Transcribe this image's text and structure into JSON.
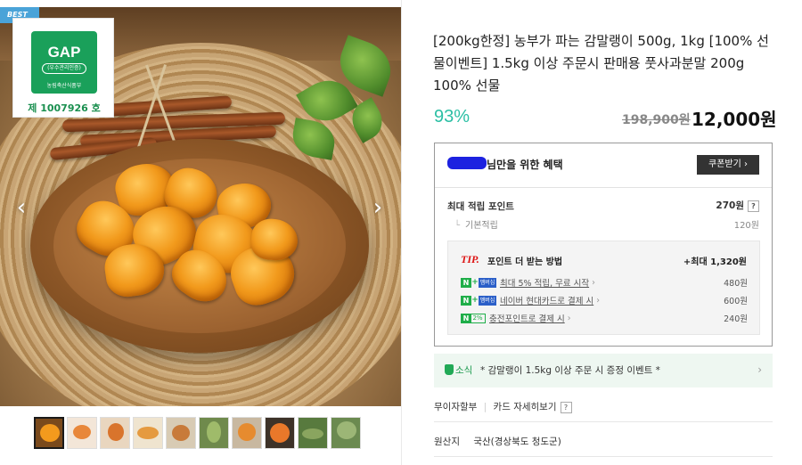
{
  "badge": {
    "best": "BEST"
  },
  "certification": {
    "mark": "GAP",
    "sub": "(우수관리인증)",
    "ministry": "농림축산식품부",
    "number": "제 1007926 호"
  },
  "gallery": {
    "prev_icon": "chevron-left-icon",
    "next_icon": "chevron-right-icon",
    "prev_glyph": "‹",
    "next_glyph": "›",
    "thumb_count": 10
  },
  "product": {
    "title": "[200kg한정] 농부가 파는 감말랭이 500g, 1kg [100% 선물이벤트] 1.5kg 이상 주문시 판매용 풋사과분말 200g 100% 선물",
    "discount": "93%",
    "original_price": "198,900원",
    "sale_price": "12,000원"
  },
  "benefit": {
    "title": "님만을 위한 혜택",
    "coupon_button": "쿠폰받기 ›",
    "max_points_label": "최대 적립 포인트",
    "max_points_value": "270원",
    "help": "?",
    "basic_label": "기본적립",
    "basic_value": "120원",
    "tip": {
      "label": "TIP.",
      "text": "포인트 더 받는 방법",
      "max": "+최대 1,320원",
      "items": [
        {
          "tag_n": "N",
          "tag_plus": "+",
          "tag_mem": "멤버십",
          "text": "최대 5% 적립, 무료 시작",
          "chevron": "›",
          "amount": "480원"
        },
        {
          "tag_n": "N",
          "tag_plus": "+",
          "tag_mem": "멤버십",
          "text": "네이버 현대카드로 결제 시",
          "chevron": "›",
          "amount": "600원"
        },
        {
          "tag_n": "N",
          "tag_pct": "2%",
          "text": "충전포인트로 결제 시",
          "chevron": "›",
          "amount": "240원"
        }
      ]
    }
  },
  "news": {
    "label": "소식",
    "text": "* 감말랭이 1.5kg 이상 주문 시 증정 이벤트 *",
    "chevron": "›"
  },
  "installment": {
    "label": "무이자할부",
    "link": "카드 자세히보기",
    "help": "?"
  },
  "origin": {
    "label": "원산지",
    "value": "국산(경상북도 청도군)"
  },
  "colors": {
    "discount": "#2bbfa4",
    "gap_green": "#1aa05a",
    "best_blue": "#4aa3d8",
    "naver_green": "#1fae49",
    "tip_red": "#dd1111"
  }
}
